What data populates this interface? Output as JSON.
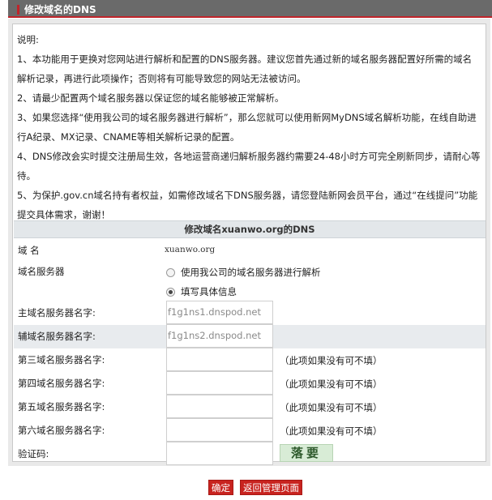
{
  "header": {
    "title": "修改域名的DNS"
  },
  "notes": {
    "heading": "说明:",
    "items": [
      "1、本功能用于更换对您网站进行解析和配置的DNS服务器。建议您首先通过新的域名服务器配置好所需的域名解析记录，再进行此项操作；否则将有可能导致您的网站无法被访问。",
      "2、请最少配置两个域名服务器以保证您的域名能够被正常解析。",
      "3、如果您选择“使用我公司的域名服务器进行解析”，那么您就可以使用新网MyDNS域名解析功能，在线自助进行A纪录、MX记录、CNAME等相关解析记录的配置。",
      "4、DNS修改会实时提交注册局生效，各地运营商递归解析服务器约需要24-48小时方可完全刷新同步，请耐心等待。",
      "5、为保护.gov.cn域名持有者权益，如需修改域名下DNS服务器，请您登陆新网会员平台，通过“在线提问”功能提交具体需求，谢谢！"
    ]
  },
  "form": {
    "section_title": "修改域名xuanwo.org的DNS",
    "domain": {
      "label": "域 名",
      "value": "xuanwo.org"
    },
    "server_mode": {
      "label": "域名服务器",
      "options": [
        "使用我公司的域名服务器进行解析",
        "填写具体信息"
      ],
      "selected": "填写具体信息"
    },
    "ns1": {
      "label": "主域名服务器名字:",
      "value": "f1g1ns1.dnspod.net"
    },
    "ns2": {
      "label": "辅域名服务器名字:",
      "value": "f1g1ns2.dnspod.net"
    },
    "ns3": {
      "label": "第三域名服务器名字:",
      "value": "",
      "hint": "（此项如果没有可不填）"
    },
    "ns4": {
      "label": "第四域名服务器名字:",
      "value": "",
      "hint": "（此项如果没有可不填）"
    },
    "ns5": {
      "label": "第五域名服务器名字:",
      "value": "",
      "hint": "（此项如果没有可不填）"
    },
    "ns6": {
      "label": "第六域名服务器名字:",
      "value": "",
      "hint": "（此项如果没有可不填）"
    },
    "captcha": {
      "label": "验证码:",
      "value": "",
      "image_text": "落要"
    }
  },
  "buttons": {
    "confirm": "确定",
    "back": "返回管理页面"
  },
  "colors": {
    "accent": "#c8231f",
    "header_bg": "#6a6a6a",
    "section_bg": "#e3e7ea",
    "row_shade": "#e8ebee"
  }
}
